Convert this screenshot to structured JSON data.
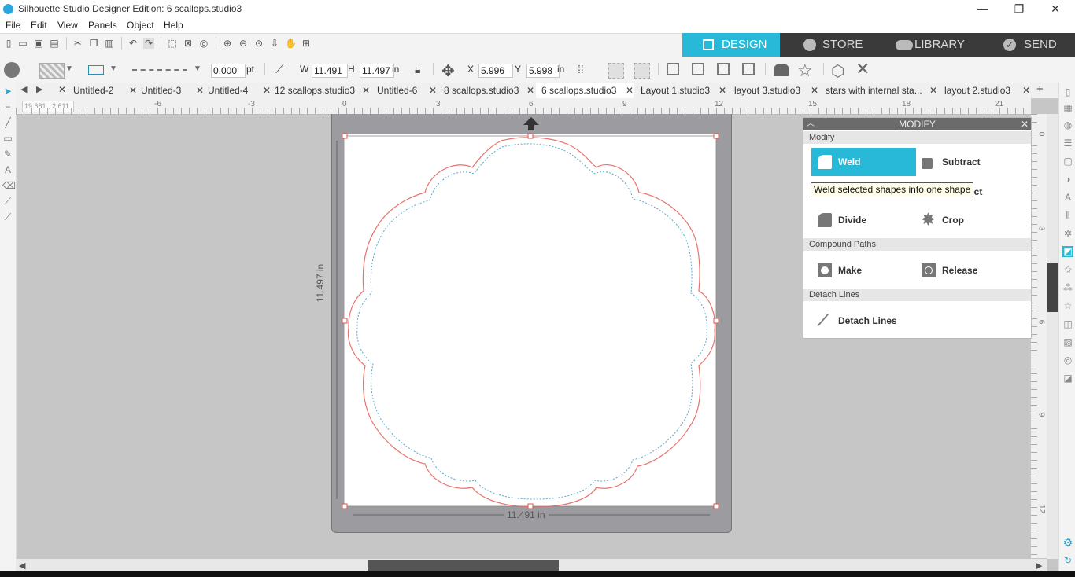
{
  "window": {
    "title": "Silhouette Studio Designer Edition: 6 scallops.studio3",
    "minimize": "—",
    "restore": "❐",
    "close": "✕"
  },
  "menu": [
    "File",
    "Edit",
    "View",
    "Panels",
    "Object",
    "Help"
  ],
  "nav_tabs": [
    {
      "label": "DESIGN",
      "icon": "grid-icon"
    },
    {
      "label": "STORE",
      "icon": "store-s-icon"
    },
    {
      "label": "LIBRARY",
      "icon": "cloud-download-icon"
    },
    {
      "label": "SEND",
      "icon": "check-circle-icon"
    }
  ],
  "line_props": {
    "width": "0.000",
    "unit": "pt"
  },
  "size": {
    "w_label": "W",
    "w": "11.491",
    "h_label": "H",
    "h": "11.497",
    "unit": "in"
  },
  "position": {
    "x_label": "X",
    "x": "5.996",
    "y_label": "Y",
    "y": "5.998",
    "unit": "in"
  },
  "doc_tabs": [
    "Untitled-2",
    "Untitled-3",
    "Untitled-4",
    "12 scallops.studio3",
    "Untitled-6",
    "8 scallops.studio3",
    "6 scallops.studio3",
    "Layout 1.studio3",
    "layout 3.studio3",
    "stars with internal sta...",
    "layout 2.studio3"
  ],
  "active_tab_index": 6,
  "tab_nav": {
    "prev": "◀",
    "next": "▶",
    "close": "✕",
    "add": "+"
  },
  "ruler": {
    "coords": "19.681 , 2.611",
    "h_ticks": [
      "-6",
      "-3",
      "0",
      "3",
      "6",
      "9",
      "12",
      "15",
      "18",
      "21"
    ],
    "v_ticks": [
      "0",
      "3",
      "6",
      "9",
      "12"
    ]
  },
  "selection": {
    "width_label": "11.491 in",
    "height_label": "11.497 in"
  },
  "modify_panel": {
    "title": "MODIFY",
    "sections": {
      "modify": "Modify",
      "compound": "Compound Paths",
      "detach": "Detach Lines"
    },
    "buttons": {
      "weld": "Weld",
      "subtract": "Subtract",
      "intersect_partial": "ect",
      "divide": "Divide",
      "crop": "Crop",
      "make": "Make",
      "release": "Release",
      "detach_lines": "Detach Lines"
    },
    "tooltip": "Weld selected shapes into one shape"
  },
  "colors": {
    "accent": "#28b9d8",
    "cut_line": "#e8736c",
    "offset_line": "#5aa9c8",
    "dark_nav": "#3a3a3a"
  }
}
